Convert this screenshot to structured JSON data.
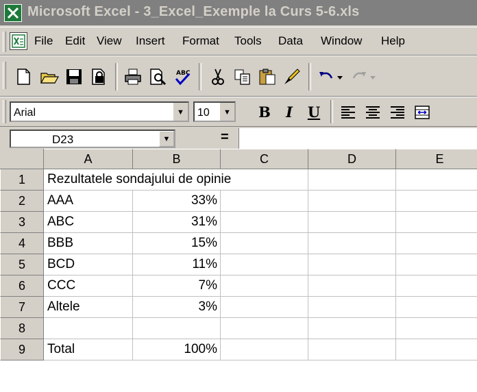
{
  "window": {
    "title": "Microsoft Excel - 3_Excel_Exemple la Curs 5-6.xls"
  },
  "menu": {
    "items": [
      "File",
      "Edit",
      "View",
      "Insert",
      "Format",
      "Tools",
      "Data",
      "Window",
      "Help"
    ]
  },
  "toolbar": {
    "standard_icons": [
      "new-icon",
      "open-icon",
      "save-icon",
      "permission-icon",
      "print-icon",
      "print-preview-icon",
      "spelling-icon",
      "cut-icon",
      "copy-icon",
      "paste-icon",
      "format-painter-icon",
      "undo-icon",
      "redo-icon"
    ]
  },
  "formatting": {
    "font_name": "Arial",
    "font_size": "10",
    "bold_label": "B",
    "italic_label": "I",
    "underline_label": "U"
  },
  "formula_bar": {
    "name_box": "D23",
    "equals": "=",
    "content": ""
  },
  "sheet": {
    "columns": [
      "A",
      "B",
      "C",
      "D",
      "E"
    ],
    "rows": [
      {
        "num": "1",
        "a": "Rezultatele sondajului de opinie",
        "b": ""
      },
      {
        "num": "2",
        "a": "AAA",
        "b": "33%"
      },
      {
        "num": "3",
        "a": "ABC",
        "b": "31%"
      },
      {
        "num": "4",
        "a": "BBB",
        "b": "15%"
      },
      {
        "num": "5",
        "a": "BCD",
        "b": "11%"
      },
      {
        "num": "6",
        "a": "CCC",
        "b": "7%"
      },
      {
        "num": "7",
        "a": "Altele",
        "b": "3%"
      },
      {
        "num": "8",
        "a": "",
        "b": ""
      },
      {
        "num": "9",
        "a": "Total",
        "b": "100%"
      }
    ]
  },
  "colors": {
    "title_bar_inactive": "#808080",
    "chrome": "#d4d0c8",
    "excel_green": "#1e7a3a"
  }
}
